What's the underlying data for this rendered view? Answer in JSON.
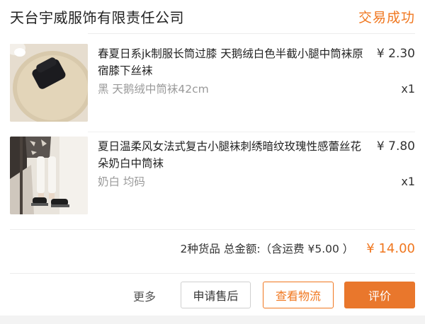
{
  "order": {
    "shop_name": "天台宇威服饰有限责任公司",
    "status": "交易成功"
  },
  "items": [
    {
      "title": "春夏日系jk制服长筒过膝 天鹅绒白色半截小腿中筒袜原宿膝下丝袜",
      "price": "¥ 2.30",
      "sku": "黑 天鹅绒中筒袜42cm",
      "quantity": "x1",
      "thumbnail_icon": "black-socks-on-round-mat-photo"
    },
    {
      "title": "夏日温柔风女法式复古小腿袜刺绣暗纹玫瑰性感蕾丝花朵奶白中筒袜",
      "price": "¥ 7.80",
      "sku": "奶白 均码",
      "quantity": "x1",
      "thumbnail_icon": "white-socks-model-photo"
    }
  ],
  "summary": {
    "text": "2种货品 总金额:（含运费 ¥5.00 ）",
    "total": "¥ 14.00"
  },
  "actions": {
    "more": "更多",
    "after_sale": "申请售后",
    "logistics": "查看物流",
    "review": "评价"
  },
  "colors": {
    "accent": "#f0771f",
    "review_button": "#e9772c",
    "muted_text": "#9a9a9a"
  }
}
